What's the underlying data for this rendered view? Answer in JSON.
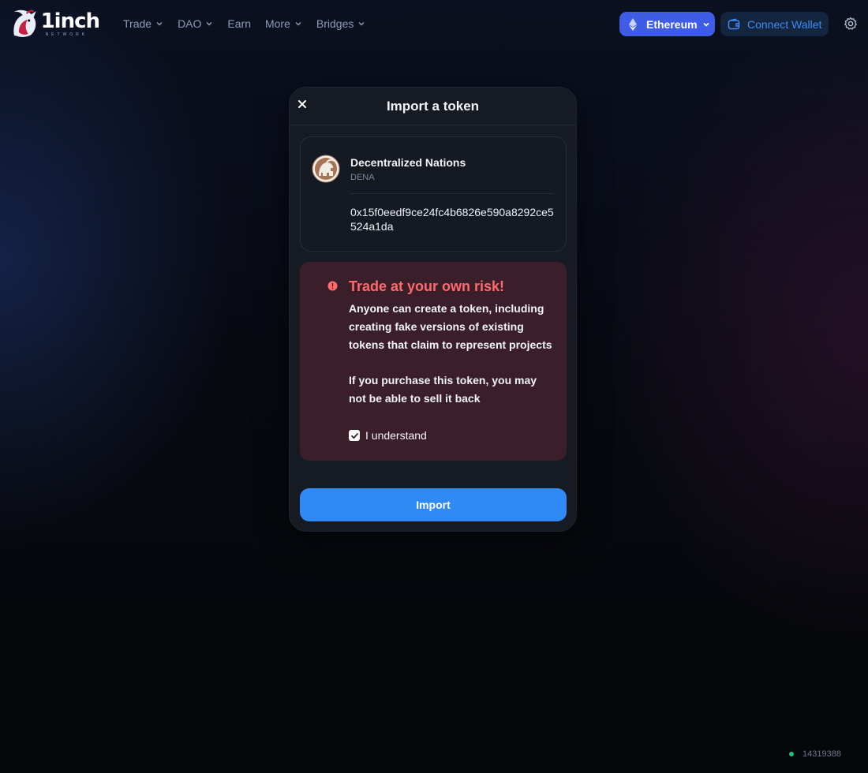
{
  "header": {
    "logo": {
      "word": "1inch",
      "sub": "NETWORK"
    },
    "nav": [
      {
        "label": "Trade",
        "has_dropdown": true
      },
      {
        "label": "DAO",
        "has_dropdown": true
      },
      {
        "label": "Earn",
        "has_dropdown": false
      },
      {
        "label": "More",
        "has_dropdown": true
      },
      {
        "label": "Bridges",
        "has_dropdown": true
      }
    ],
    "network": {
      "label": "Ethereum",
      "icon": "ethereum-icon"
    },
    "wallet": {
      "label": "Connect Wallet",
      "icon": "wallet-icon"
    },
    "settings_icon": "gear-icon"
  },
  "modal": {
    "title": "Import a token",
    "close_icon": "close-icon",
    "token": {
      "name": "Decentralized Nations",
      "symbol": "DENA",
      "address": "0x15f0eedf9ce24fc4b6826e590a8292ce5524a1da"
    },
    "warning": {
      "title": "Trade at your own risk!",
      "text1": "Anyone can create a token, including creating fake versions of existing tokens that claim to represent projects",
      "text2": "If you purchase this token, you may not be able to sell it back",
      "checkbox_label": "I understand",
      "checked": true
    },
    "import_label": "Import"
  },
  "footer": {
    "block_number": "14319388"
  },
  "colors": {
    "accent": "#3e5ce6",
    "import_button": "#2f8af5",
    "warning_title": "#ff6b6b",
    "warning_bg": "#3a1f2b",
    "status_dot": "#25c17a"
  }
}
